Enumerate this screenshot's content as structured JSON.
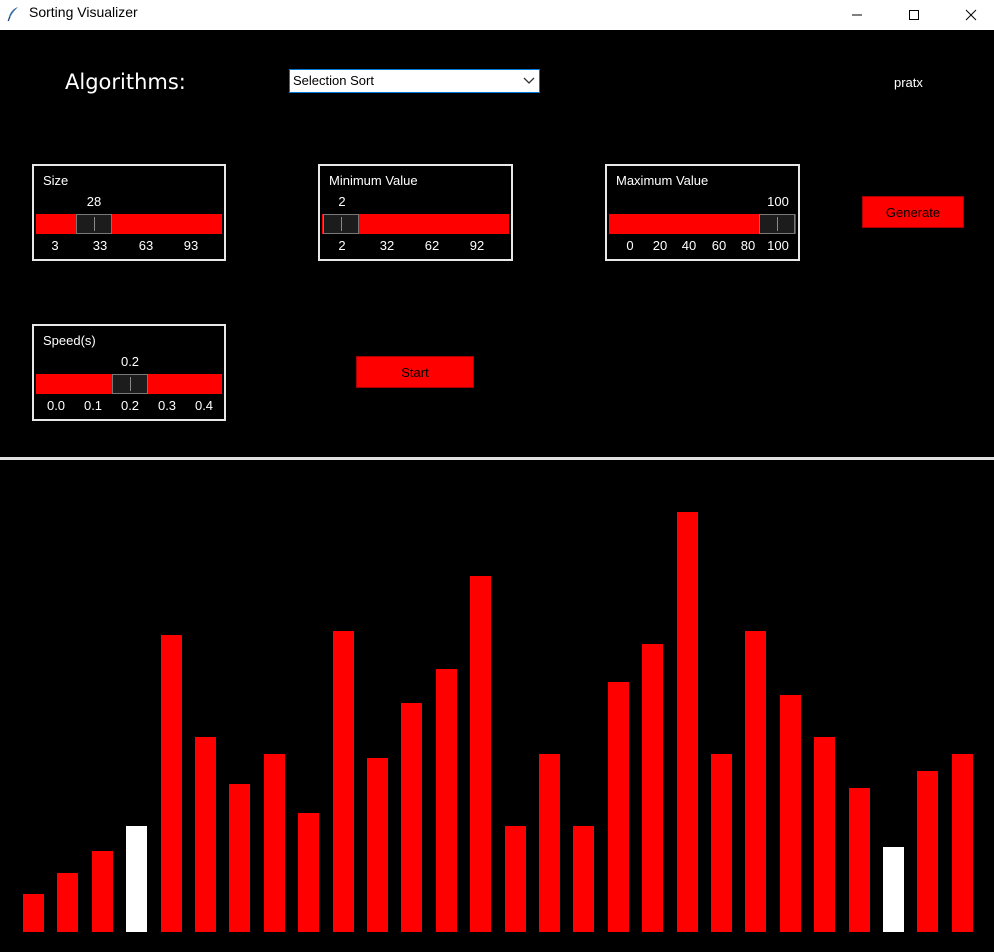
{
  "window": {
    "title": "Sorting Visualizer",
    "icon": "feather-icon"
  },
  "header": {
    "algorithms_label": "Algorithms:",
    "algorithm_selected": "Selection Sort",
    "author": "pratx"
  },
  "size": {
    "label": "Size",
    "value": "28",
    "min": 3,
    "max": 120,
    "fraction": 0.213,
    "ticks": [
      "3",
      "33",
      "63",
      "93"
    ]
  },
  "min_value": {
    "label": "Minimum Value",
    "value": "2",
    "min": 2,
    "max": 120,
    "fraction": 0.0,
    "ticks": [
      "2",
      "32",
      "62",
      "92"
    ]
  },
  "max_value": {
    "label": "Maximum Value",
    "value": "100",
    "min": 0,
    "max": 100,
    "fraction": 1.0,
    "ticks": [
      "0",
      "20",
      "40",
      "60",
      "80",
      "100"
    ]
  },
  "speed": {
    "label": "Speed(s)",
    "value": "0.2",
    "min": 0.0,
    "max": 0.4,
    "fraction": 0.5,
    "ticks": [
      "0.0",
      "0.1",
      "0.2",
      "0.3",
      "0.4"
    ]
  },
  "buttons": {
    "generate": "Generate",
    "start": "Start"
  },
  "colors": {
    "bar": "#ff0000",
    "highlight": "#ffffff",
    "background": "#000000"
  },
  "chart_data": {
    "type": "bar",
    "values": [
      9,
      14,
      19,
      25,
      70,
      46,
      35,
      42,
      28,
      71,
      41,
      54,
      62,
      84,
      25,
      42,
      25,
      59,
      68,
      99,
      42,
      71,
      56,
      46,
      34,
      20,
      38,
      42
    ],
    "highlighted": [
      3,
      25
    ],
    "ylim": [
      0,
      100
    ]
  }
}
